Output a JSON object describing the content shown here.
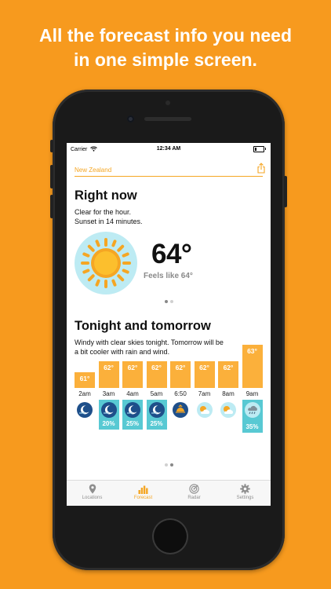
{
  "headline": {
    "line1": "All the forecast info you need",
    "line2": "in one simple screen."
  },
  "status_bar": {
    "carrier": "Carrier",
    "time": "12:34 AM"
  },
  "nav": {
    "location": "New Zealand",
    "share_icon": "share-icon"
  },
  "right_now": {
    "title": "Right now",
    "summary_line1": "Clear for the hour.",
    "summary_line2": "Sunset in 14 minutes.",
    "icon": "sun-icon",
    "temperature": "64°",
    "feels_like": "Feels like 64°",
    "page_index": 0,
    "page_count": 2
  },
  "tonight": {
    "title": "Tonight and tomorrow",
    "summary_line1": "Windy with clear skies tonight. Tomorrow will be",
    "summary_line2": "a bit cooler with rain and wind.",
    "page_index": 1,
    "page_count": 2,
    "hours": [
      {
        "time": "2am",
        "temp": "61°",
        "temp_value": 61,
        "icon": "moon-wind-icon",
        "precip": ""
      },
      {
        "time": "3am",
        "temp": "62°",
        "temp_value": 62,
        "icon": "moon-wind-icon",
        "precip": "20%"
      },
      {
        "time": "4am",
        "temp": "62°",
        "temp_value": 62,
        "icon": "moon-wind-icon",
        "precip": "25%"
      },
      {
        "time": "5am",
        "temp": "62°",
        "temp_value": 62,
        "icon": "moon-wind-icon",
        "precip": "25%"
      },
      {
        "time": "6:50",
        "temp": "62°",
        "temp_value": 62,
        "icon": "sunrise-icon",
        "precip": ""
      },
      {
        "time": "7am",
        "temp": "62°",
        "temp_value": 62,
        "icon": "sun-cloud-icon",
        "precip": ""
      },
      {
        "time": "8am",
        "temp": "62°",
        "temp_value": 62,
        "icon": "sun-cloud-icon",
        "precip": ""
      },
      {
        "time": "9am",
        "temp": "63°",
        "temp_value": 63,
        "icon": "rain-cloud-icon",
        "precip": "35%"
      }
    ]
  },
  "tabs": [
    {
      "label": "Locations",
      "icon": "location-pin-icon",
      "active": false
    },
    {
      "label": "Forecast",
      "icon": "bar-chart-icon",
      "active": true
    },
    {
      "label": "Radar",
      "icon": "radar-icon",
      "active": false
    },
    {
      "label": "Settings",
      "icon": "gear-icon",
      "active": false
    }
  ],
  "colors": {
    "background": "#F79A1E",
    "accent": "#F5A623",
    "temp_bar": "#FBB03B",
    "precip_bar": "#58C9D3",
    "night_icon": "#1E4F8A",
    "sun_circle": "#BDEBF3"
  }
}
